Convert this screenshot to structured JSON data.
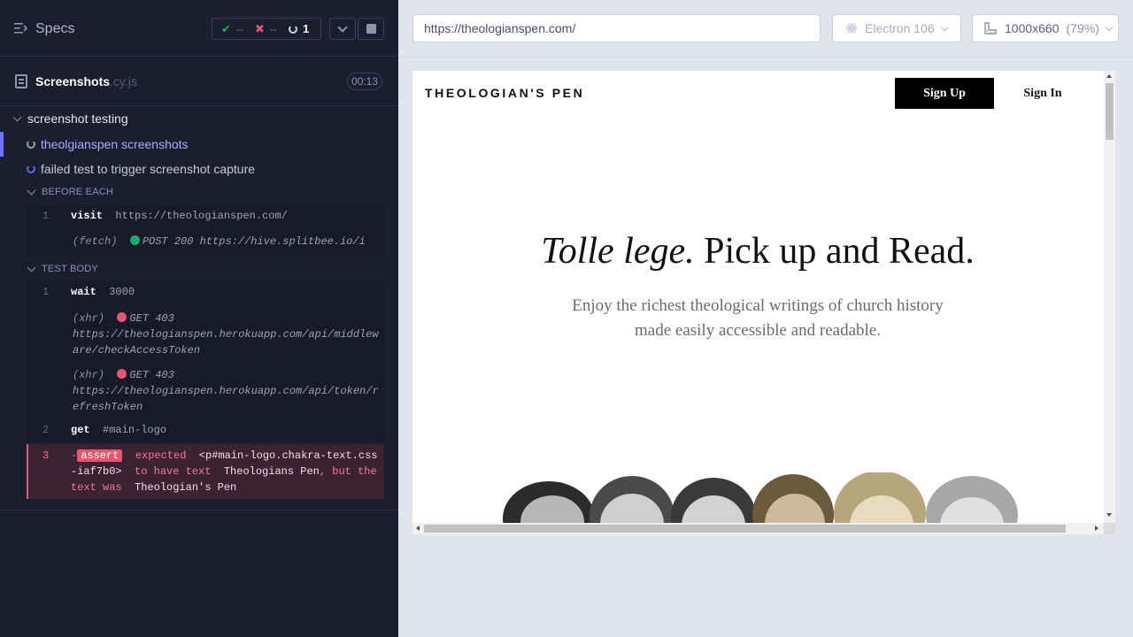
{
  "reporter": {
    "specs_label": "Specs",
    "stats": {
      "passed": "--",
      "failed": "--",
      "pending": "1"
    },
    "spec_file": {
      "name": "Screenshots",
      "ext": ".cy.js",
      "duration": "00:13"
    },
    "suite": "screenshot testing",
    "tests": [
      {
        "title": "theolgianspen screenshots",
        "state": "running"
      },
      {
        "title": "failed test to trigger screenshot capture",
        "state": "pending"
      }
    ],
    "before_each": {
      "label": "BEFORE EACH",
      "commands": [
        {
          "num": "1",
          "name": "visit",
          "arg": "https://theologianspen.com/"
        }
      ],
      "requests": [
        {
          "type": "(fetch)",
          "status_color": "#1fa971",
          "text": "POST 200 https://hive.splitbee.io/i"
        }
      ]
    },
    "test_body": {
      "label": "TEST BODY",
      "commands": [
        {
          "num": "1",
          "name": "wait",
          "arg": "3000"
        },
        {
          "num": "2",
          "name": "get",
          "arg": "#main-logo"
        }
      ],
      "requests": [
        {
          "type": "(xhr)",
          "status_color": "#e45770",
          "text": "GET 403",
          "url": "https://theologianspen.herokuapp.com/api/middleware/checkAccessToken"
        },
        {
          "type": "(xhr)",
          "status_color": "#e45770",
          "text": "GET 403",
          "url": "https://theologianspen.herokuapp.com/api/token/refreshToken"
        }
      ],
      "error": {
        "num": "3",
        "prefix": "-",
        "badge": "assert",
        "word_expected": "expected",
        "selector": "<p#main-logo.chakra-text.css-iaf7b0>",
        "to_have_text": "to have text",
        "expected_text": "Theologians Pen",
        "but_the_text_was": ", but the text was",
        "actual_text": "Theologian's Pen"
      }
    }
  },
  "browser": {
    "url": "https://theologianspen.com/",
    "browser_name": "Electron 106",
    "viewport": "1000x660",
    "zoom": "(79%)"
  },
  "aut": {
    "logo": "THEOLOGIAN'S PEN",
    "signup": "Sign Up",
    "signin": "Sign In",
    "hero_italic": "Tolle lege.",
    "hero_rest": " Pick up and Read.",
    "sub_line1": "Enjoy the richest theological writings of church history",
    "sub_line2": "made easily accessible and readable."
  },
  "colors": {
    "reporter_bg": "#1b1e2e",
    "accent_active": "#6c72ff",
    "pass": "#1fa971",
    "fail": "#e45770"
  }
}
